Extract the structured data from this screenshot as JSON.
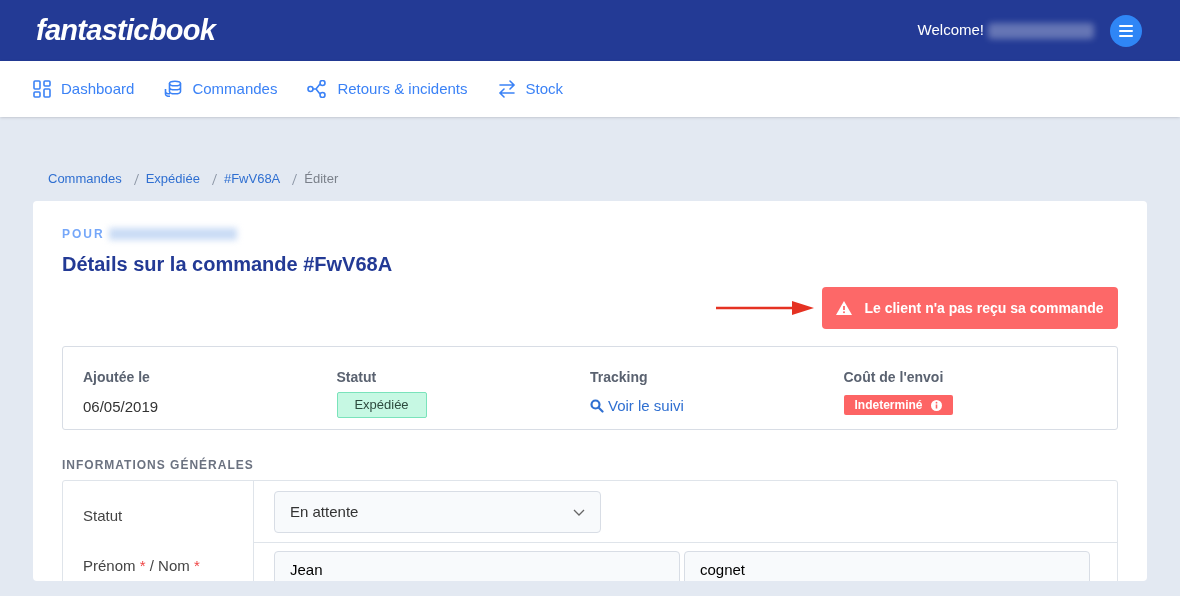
{
  "header": {
    "logo": "fantasticbook",
    "welcome": "Welcome!"
  },
  "nav": [
    {
      "label": "Dashboard"
    },
    {
      "label": "Commandes"
    },
    {
      "label": "Retours & incidents"
    },
    {
      "label": "Stock"
    }
  ],
  "breadcrumb": [
    {
      "label": "Commandes",
      "link": true
    },
    {
      "label": "Expédiée",
      "link": true
    },
    {
      "label": "#FwV68A",
      "link": true
    },
    {
      "label": "Éditer",
      "link": false
    }
  ],
  "card": {
    "for_label": "POUR",
    "title": "Détails sur la commande #FwV68A",
    "alert_button": "Le client n'a pas reçu sa commande",
    "summary": [
      {
        "kind": "text",
        "label": "Ajoutée le",
        "value": "06/05/2019"
      },
      {
        "kind": "status",
        "label": "Statut",
        "value": "Expédiée"
      },
      {
        "kind": "link",
        "label": "Tracking",
        "value": "Voir le suivi"
      },
      {
        "kind": "warning",
        "label": "Coût de l'envoi",
        "value": "Indeterminé"
      }
    ],
    "section_title": "INFORMATIONS GÉNÉRALES",
    "status_field": {
      "label": "Statut",
      "value": "En attente"
    },
    "name_row": {
      "labels": [
        {
          "text": "Prénom",
          "mark": "*"
        },
        {
          "text": "Nom",
          "mark": "*"
        }
      ],
      "separator": "/",
      "values": [
        "Jean",
        "cognet"
      ]
    }
  }
}
